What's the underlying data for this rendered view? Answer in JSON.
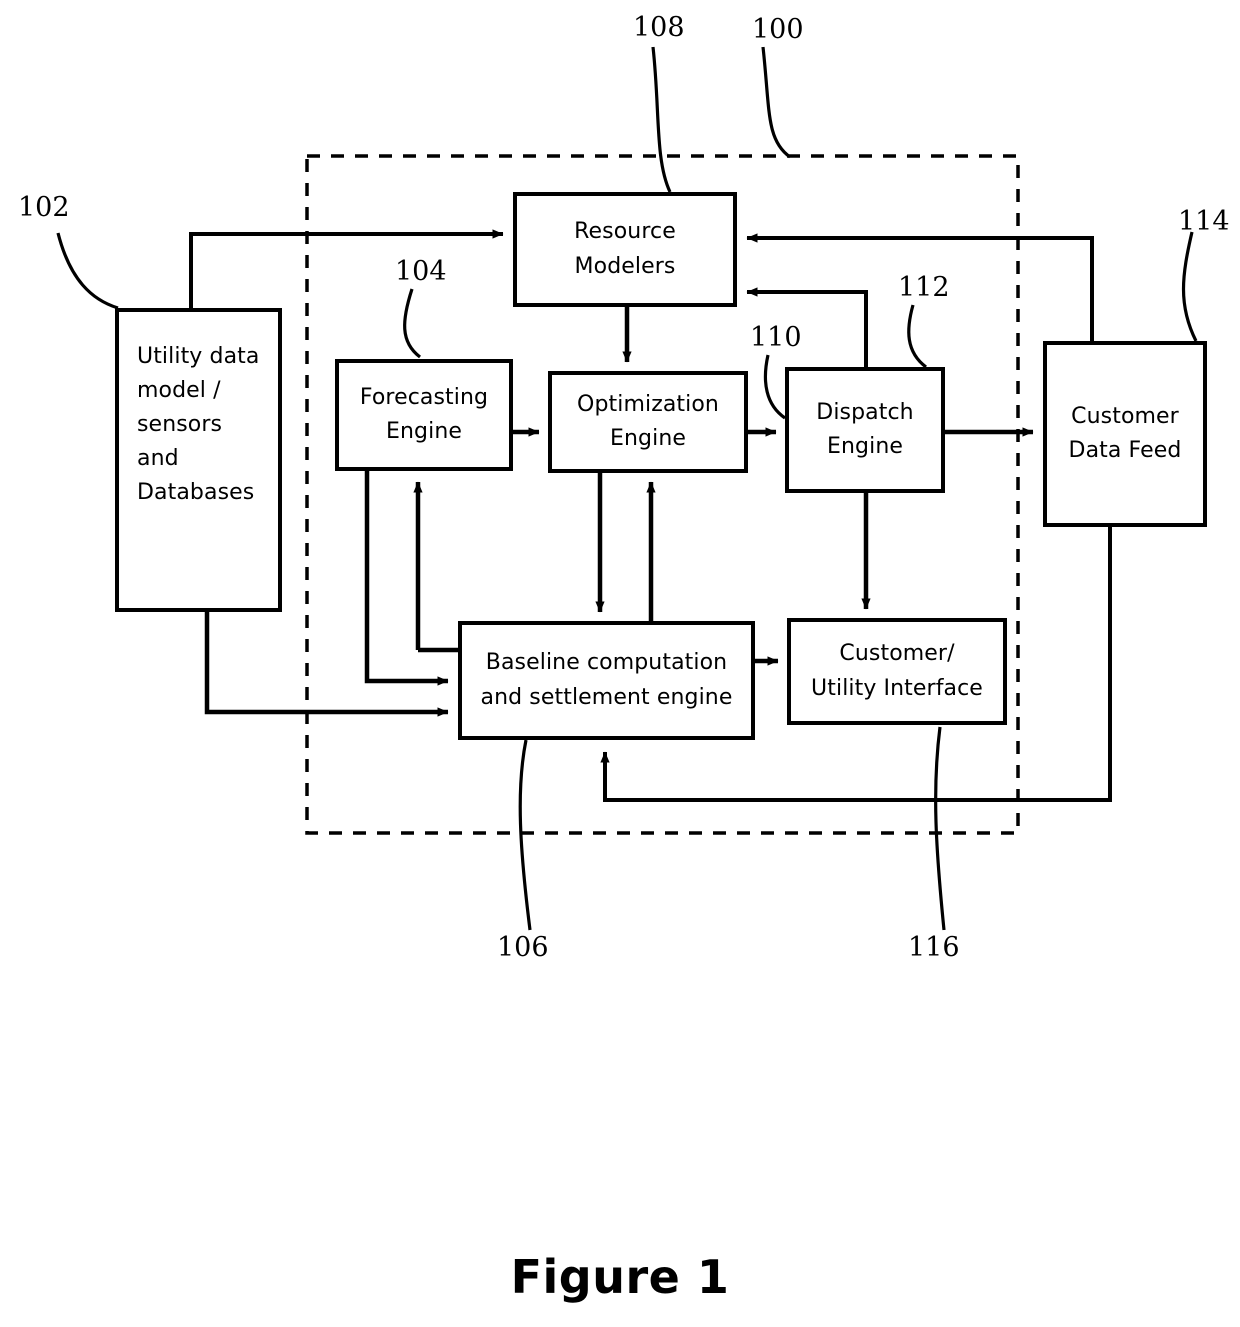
{
  "figure": {
    "caption": "Figure 1",
    "system_boundary_ref": "100"
  },
  "nodes": [
    {
      "id": "utility-data-model",
      "ref": "102",
      "lines": [
        "Utility data",
        "model /",
        "sensors",
        "and",
        "Databases"
      ],
      "inside_boundary": false
    },
    {
      "id": "forecasting-engine",
      "ref": "104",
      "lines": [
        "Forecasting",
        "Engine"
      ],
      "inside_boundary": true
    },
    {
      "id": "baseline-settlement-engine",
      "ref": "106",
      "lines": [
        "Baseline computation",
        "and settlement engine"
      ],
      "inside_boundary": true
    },
    {
      "id": "resource-modelers",
      "ref": "108",
      "lines": [
        "Resource",
        "Modelers"
      ],
      "inside_boundary": true
    },
    {
      "id": "optimization-engine",
      "ref": "110",
      "lines": [
        "Optimization",
        "Engine"
      ],
      "inside_boundary": true
    },
    {
      "id": "dispatch-engine",
      "ref": "112",
      "lines": [
        "Dispatch",
        "Engine"
      ],
      "inside_boundary": true
    },
    {
      "id": "customer-data-feed",
      "ref": "114",
      "lines": [
        "Customer",
        "Data Feed"
      ],
      "inside_boundary": false
    },
    {
      "id": "customer-utility-interface",
      "ref": "116",
      "lines": [
        "Customer/",
        "Utility Interface"
      ],
      "inside_boundary": true
    }
  ],
  "reference_numerals": {
    "n100": "100",
    "n102": "102",
    "n104": "104",
    "n106": "106",
    "n108": "108",
    "n110": "110",
    "n112": "112",
    "n114": "114",
    "n116": "116"
  },
  "colors": {
    "stroke": "#000000",
    "background": "#ffffff"
  }
}
